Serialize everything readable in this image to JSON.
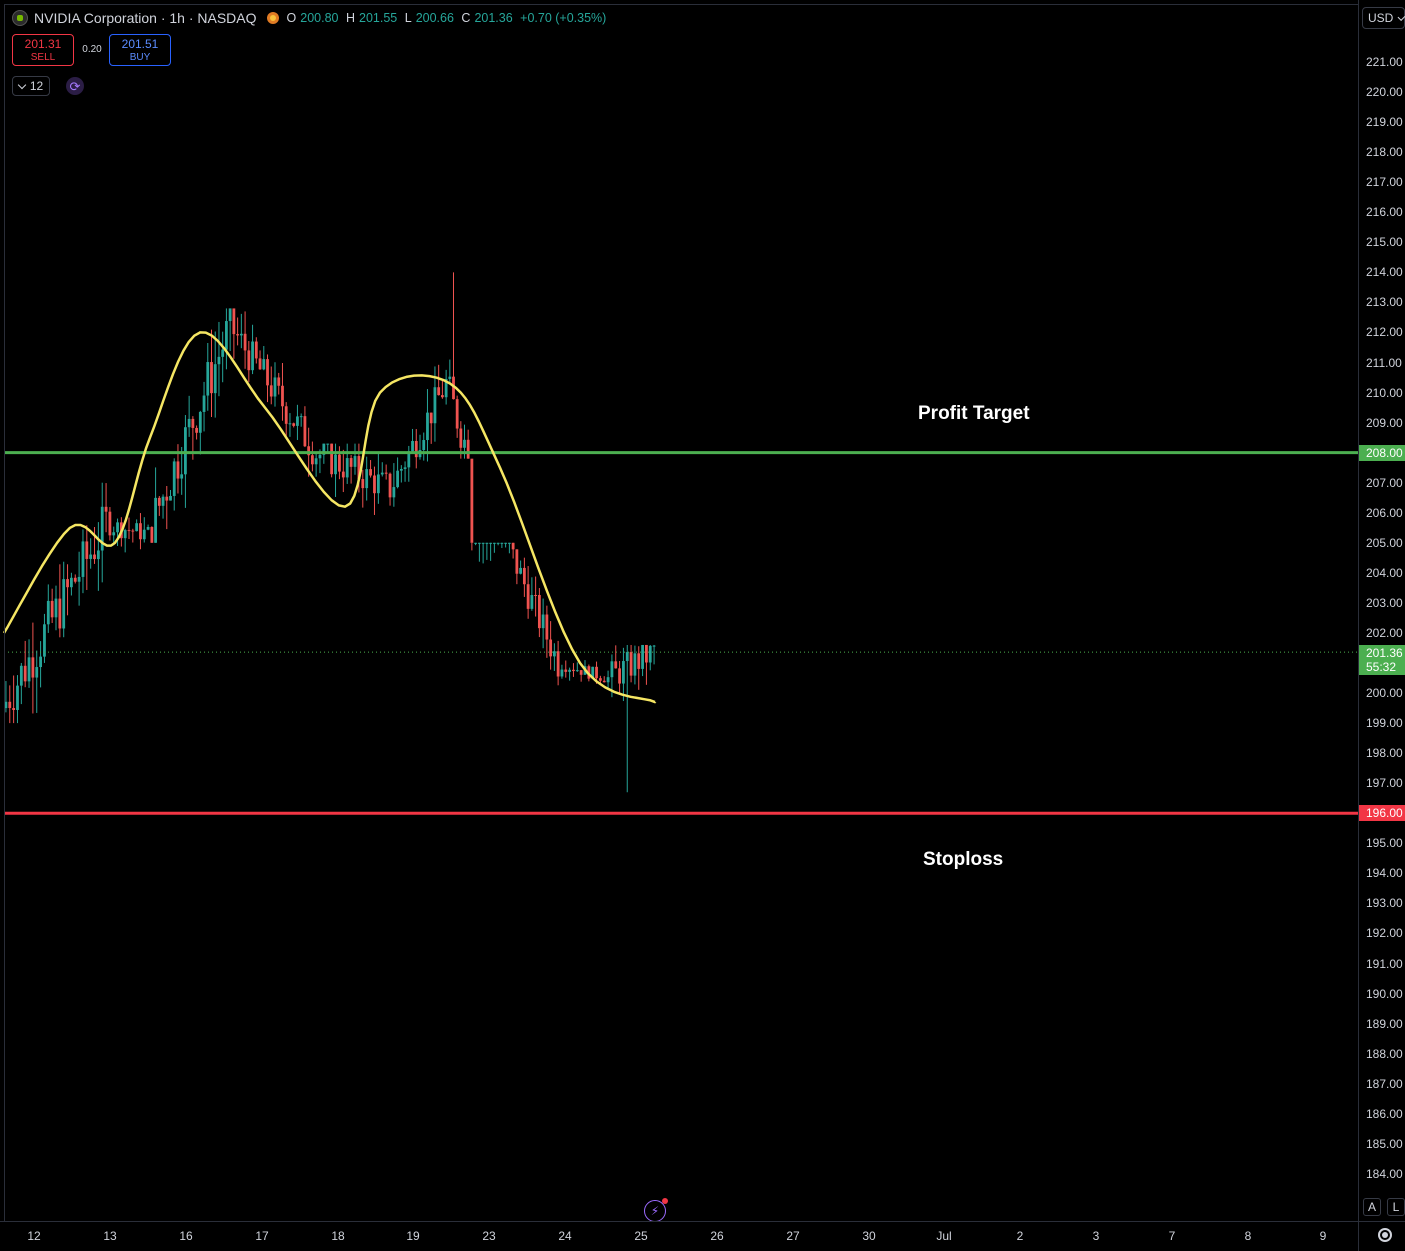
{
  "header": {
    "symbol_title": "NVIDIA Corporation · 1h · NASDAQ",
    "ohlc": {
      "o_key": "O",
      "o": "200.80",
      "h_key": "H",
      "h": "201.55",
      "l_key": "L",
      "l": "200.66",
      "c_key": "C",
      "c": "201.36",
      "change": "+0.70 (+0.35%)"
    }
  },
  "trade": {
    "sell_price": "201.31",
    "sell_label": "SELL",
    "spread": "0.20",
    "buy_price": "201.51",
    "buy_label": "BUY"
  },
  "toolbar": {
    "interval_value": "12",
    "currency": "USD",
    "auto_label": "A",
    "log_label": "L"
  },
  "price_axis": {
    "ticks": [
      "221.00",
      "220.00",
      "219.00",
      "218.00",
      "217.00",
      "216.00",
      "215.00",
      "214.00",
      "213.00",
      "212.00",
      "211.00",
      "210.00",
      "209.00",
      "207.00",
      "206.00",
      "205.00",
      "204.00",
      "203.00",
      "202.00",
      "200.00",
      "199.00",
      "198.00",
      "197.00",
      "195.00",
      "194.00",
      "193.00",
      "192.00",
      "191.00",
      "190.00",
      "189.00",
      "188.00",
      "187.00",
      "186.00",
      "185.00",
      "184.00"
    ],
    "target_tag": "208.00",
    "stop_tag": "196.00",
    "last_price": "201.36",
    "countdown": "55:32"
  },
  "time_axis": {
    "labels": [
      "12",
      "13",
      "16",
      "17",
      "18",
      "19",
      "23",
      "24",
      "25",
      "26",
      "27",
      "30",
      "Jul",
      "2",
      "3",
      "7",
      "8",
      "9"
    ]
  },
  "annotations": {
    "profit_target": "Profit Target",
    "stoploss": "Stoploss"
  },
  "colors": {
    "up": "#26a69a",
    "down": "#ef5350",
    "ma": "#f5e663",
    "target_line": "#4caf50",
    "stop_line": "#f23645",
    "background": "#000000"
  },
  "chart_data": {
    "type": "candlestick",
    "interval": "1h",
    "y_range": [
      183.5,
      221.5
    ],
    "x_categories": [
      "12",
      "13",
      "16",
      "17",
      "18",
      "19",
      "23",
      "24",
      "25",
      "26",
      "27",
      "30",
      "Jul",
      "2",
      "3",
      "7",
      "8",
      "9"
    ],
    "horizontal_lines": [
      {
        "price": 208.0
      },
      {
        "price": 196.0
      }
    ],
    "last_price": 201.36,
    "segments": [
      {
        "day": "12",
        "open": 199.5,
        "close": 205.6,
        "high": 207.0,
        "low": 199.0
      },
      {
        "day": "13",
        "open": 205.6,
        "close": 205.3,
        "high": 206.7,
        "low": 203.6
      },
      {
        "day": "16",
        "open": 205.3,
        "close": 212.2,
        "high": 212.8,
        "low": 205.0
      },
      {
        "day": "17",
        "open": 212.2,
        "close": 208.0,
        "high": 212.7,
        "low": 207.2
      },
      {
        "day": "18",
        "open": 208.0,
        "close": 206.8,
        "high": 208.3,
        "low": 203.2
      },
      {
        "day": "19",
        "open": 206.8,
        "close": 210.3,
        "high": 211.5,
        "low": 206.2
      },
      {
        "day": "19b",
        "open": 210.3,
        "close": 208.0,
        "high": 214.0,
        "low": 207.8
      },
      {
        "day": "23",
        "open": 208.0,
        "close": 201.0,
        "high": 205.0,
        "low": 200.0
      },
      {
        "day": "24",
        "open": 201.0,
        "close": 200.5,
        "high": 202.0,
        "low": 200.0
      },
      {
        "day": "25",
        "open": 200.5,
        "close": 201.36,
        "high": 201.6,
        "low": 196.7
      }
    ],
    "moving_average": [
      {
        "day": "12",
        "value": 202.0
      },
      {
        "day": "13",
        "value": 205.5
      },
      {
        "day": "13b",
        "value": 205.0
      },
      {
        "day": "16",
        "value": 208.5
      },
      {
        "day": "16b",
        "value": 212.0
      },
      {
        "day": "17",
        "value": 209.5
      },
      {
        "day": "18",
        "value": 206.2
      },
      {
        "day": "19",
        "value": 210.0
      },
      {
        "day": "19b",
        "value": 210.3
      },
      {
        "day": "23",
        "value": 207.5
      },
      {
        "day": "24",
        "value": 201.0
      },
      {
        "day": "25",
        "value": 199.7
      }
    ]
  }
}
